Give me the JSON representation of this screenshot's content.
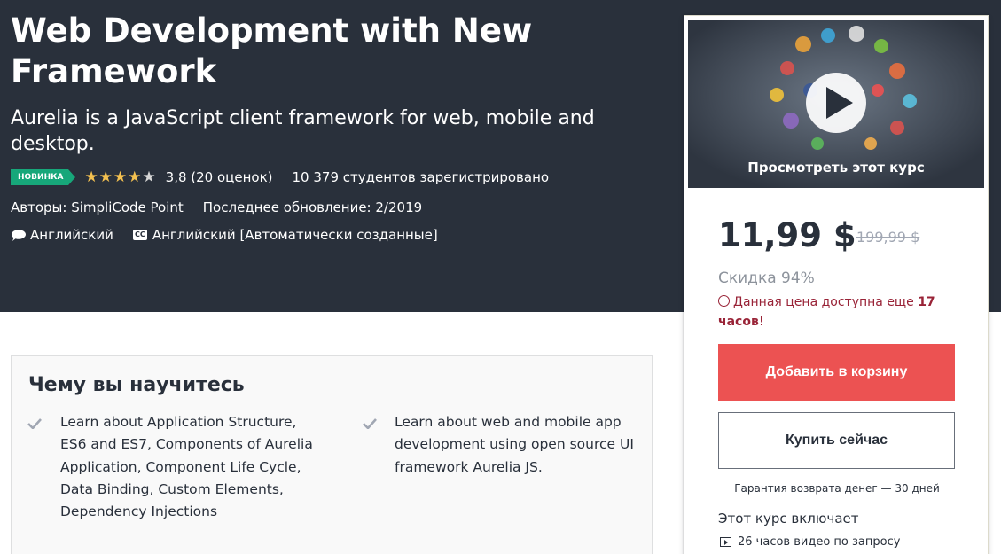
{
  "course": {
    "title": "Web Development with New Framework",
    "subtitle": "Aurelia is a JavaScript client framework for web, mobile and desktop.",
    "badge": "НОВИНКА",
    "rating_value": 3.8,
    "rating_text": "3,8 (20 оценок)",
    "students": "10 379 студентов зарегистрировано",
    "authors": "Авторы: SimpliCode Point",
    "updated": "Последнее обновление: 2/2019",
    "language": "Английский",
    "captions_badge": "CC",
    "captions": "Английский [Автоматически созданные]"
  },
  "sidebar": {
    "preview_label": "Просмотреть этот курс",
    "price": "11,99 $",
    "old_price": "199,99 $",
    "discount": "Скидка 94%",
    "timer_prefix": "Данная цена доступна еще ",
    "timer_bold": "17 часов",
    "timer_suffix": "!",
    "add_to_cart": "Добавить в корзину",
    "buy_now": "Купить сейчас",
    "guarantee": "Гарантия возврата денег — 30 дней",
    "includes_title": "Этот курс включает",
    "includes_items": [
      "26 часов видео по запросу"
    ]
  },
  "learn": {
    "title": "Чему вы научитесь",
    "items": [
      "Learn about Application Structure, ES6 and ES7, Components of Aurelia Application, Component Life Cycle, Data Binding, Custom Elements, Dependency Injections",
      "Learn about web and mobile app development using open source UI framework Aurelia JS."
    ]
  },
  "colors": {
    "hero_bg": "#29303b",
    "badge": "#17a77a",
    "star": "#f4c150",
    "cart_button": "#ec5252",
    "timer": "#992337"
  }
}
